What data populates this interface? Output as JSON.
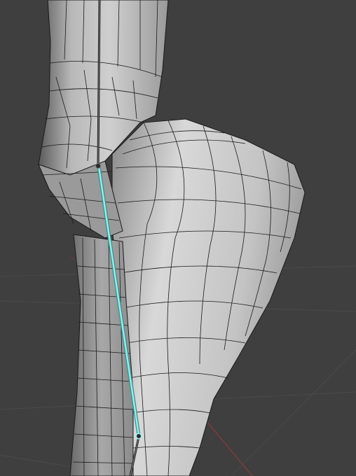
{
  "app": "3D viewport",
  "colors": {
    "background": "#3f3f3f",
    "grid": "#4a4a4a",
    "x_axis": "#8a3a3a",
    "mesh_light": "#d4d4d4",
    "mesh_dark": "#6a6a6a",
    "wire": "#1a1a1a",
    "selected_bone": "#7fe0dc",
    "bone": "#2a2a2a"
  },
  "icons": {
    "bone_head": "circle-joint-icon",
    "bone_tail": "circle-joint-icon"
  },
  "selection": {
    "bone_selected": true
  }
}
